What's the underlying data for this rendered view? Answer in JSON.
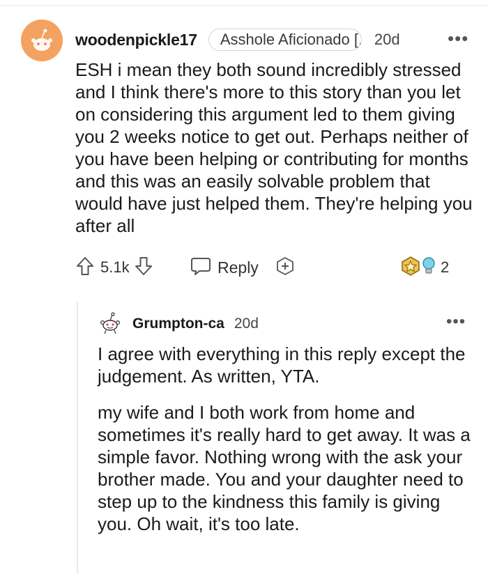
{
  "comment": {
    "username": "woodenpickle17",
    "flair": "Asshole Aficionado [...",
    "age": "20d",
    "body": "ESH i mean they both sound incredibly stressed and I think there's more to this story than you let on considering this argument led to them giving you 2 weeks notice to get out. Perhaps neither of you have been helping or contributing for months and this was an easily solvable problem that would have just helped them. They're helping you after all",
    "score": "5.1k",
    "reply_label": "Reply",
    "award_count": "2",
    "icons": {
      "avatar": "snoo-avatar-orange",
      "upvote": "upvote-arrow-icon",
      "downvote": "downvote-arrow-icon",
      "reply": "speech-bubble-icon",
      "add_award": "plus-circle-icon",
      "awards": [
        "gold-award-icon",
        "helpful-bulb-icon"
      ],
      "more": "ellipsis-icon"
    }
  },
  "reply": {
    "username": "Grumpton-ca",
    "age": "20d",
    "paragraphs": [
      "I agree with everything in this reply except the judgement. As written, YTA.",
      "my wife and I both work from home and sometimes it's really hard to get away. It was a simple favor. Nothing wrong with the ask your brother made. You and your daughter need to step up to the kindness this family is giving you. Oh wait, it's too late."
    ],
    "icons": {
      "avatar": "snoo-avatar-white",
      "more": "ellipsis-icon"
    }
  },
  "colors": {
    "avatar_bg": "#f4a261",
    "thread_line": "#e8e8e8",
    "flair_border": "#d5d5d5",
    "text": "#1a1a1b"
  }
}
